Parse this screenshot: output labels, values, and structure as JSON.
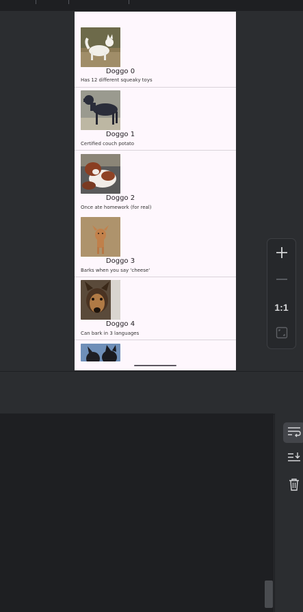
{
  "dogs": [
    {
      "name": "Doggo 0",
      "description": "Has 12 different squeaky toys"
    },
    {
      "name": "Doggo 1",
      "description": "Certified couch potato"
    },
    {
      "name": "Doggo 2",
      "description": "Once ate homework (for real)"
    },
    {
      "name": "Doggo 3",
      "description": "Barks when you say 'cheese'"
    },
    {
      "name": "Doggo 4",
      "description": "Can bark in 3 languages"
    }
  ],
  "zoom_controls": {
    "zoom_in_icon": "plus-icon",
    "zoom_out_icon": "minus-icon",
    "actual_size_label": "1:1",
    "fit_screen_icon": "fit-screen-icon"
  },
  "console_toolbar": {
    "soft_wrap_icon": "soft-wrap-icon",
    "scroll_to_end_icon": "scroll-to-end-icon",
    "clear_icon": "trash-icon"
  },
  "colors": {
    "app_background": "#fef7fd",
    "ide_background": "#2b2d30",
    "console_background": "#1e1f22"
  }
}
